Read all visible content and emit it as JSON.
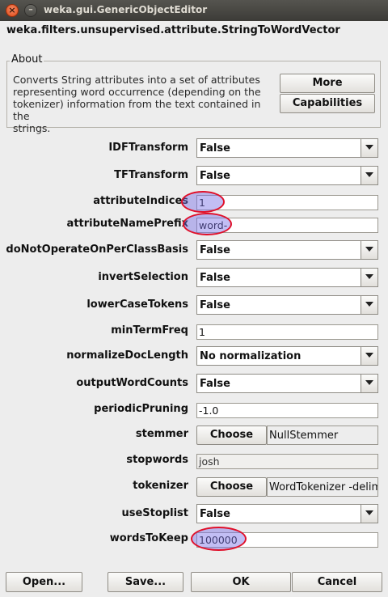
{
  "window": {
    "title": "weka.gui.GenericObjectEditor"
  },
  "class_name": "weka.filters.unsupervised.attribute.StringToWordVector",
  "about": {
    "legend": "About",
    "lines": [
      "Converts String attributes into a set of attributes",
      "representing word occurrence (depending on the",
      "tokenizer) information from the text contained in the",
      "strings."
    ],
    "more_label": "More",
    "capabilities_label": "Capabilities"
  },
  "properties": {
    "IDFTransform": {
      "label": "IDFTransform",
      "value": "False"
    },
    "TFTransform": {
      "label": "TFTransform",
      "value": "False"
    },
    "attributeIndices": {
      "label": "attributeIndices",
      "value": "1"
    },
    "attributeNamePrefix": {
      "label": "attributeNamePrefix",
      "value": "word-"
    },
    "doNotOperateOnPerClassBasis": {
      "label": "doNotOperateOnPerClassBasis",
      "value": "False"
    },
    "invertSelection": {
      "label": "invertSelection",
      "value": "False"
    },
    "lowerCaseTokens": {
      "label": "lowerCaseTokens",
      "value": "False"
    },
    "minTermFreq": {
      "label": "minTermFreq",
      "value": "1"
    },
    "normalizeDocLength": {
      "label": "normalizeDocLength",
      "value": "No normalization"
    },
    "outputWordCounts": {
      "label": "outputWordCounts",
      "value": "False"
    },
    "periodicPruning": {
      "label": "periodicPruning",
      "value": "-1.0"
    },
    "stemmer": {
      "label": "stemmer",
      "button": "Choose",
      "value": "NullStemmer"
    },
    "stopwords": {
      "label": "stopwords",
      "value": "josh"
    },
    "tokenizer": {
      "label": "tokenizer",
      "button": "Choose",
      "value": "WordTokenizer -delimiters \" \\r\\n\\t.,;:'\"()?!\""
    },
    "useStoplist": {
      "label": "useStoplist",
      "value": "False"
    },
    "wordsToKeep": {
      "label": "wordsToKeep",
      "value": "100000"
    }
  },
  "buttons": {
    "open": "Open...",
    "save": "Save...",
    "ok": "OK",
    "cancel": "Cancel"
  },
  "colors": {
    "highlight_ring": "#e0102a",
    "highlight_fill": "#786ee6",
    "titlebar": "#3c3b37"
  }
}
